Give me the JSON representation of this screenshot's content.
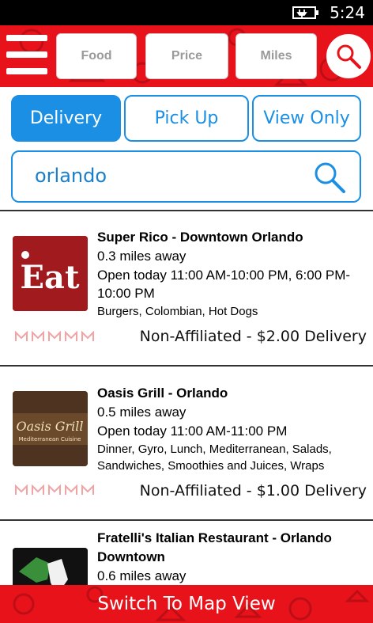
{
  "status_bar": {
    "time": "5:24",
    "battery_icon": "battery-charging-icon"
  },
  "header": {
    "menu_icon": "hamburger-menu-icon",
    "filters": [
      "Food",
      "Price",
      "Miles"
    ],
    "search_icon": "search-icon",
    "brand_color": "#e8121b"
  },
  "modes": {
    "items": [
      "Delivery",
      "Pick Up",
      "View Only"
    ],
    "selected": "Delivery",
    "accent": "#1a8fe3"
  },
  "search": {
    "value": "orlando"
  },
  "restaurants": [
    {
      "name": "Super Rico - Downtown Orlando",
      "distance": "0.3 miles away",
      "hours": "Open today 11:00 AM-10:00 PM, 6:00 PM-10:00 PM",
      "cuisine": "Burgers, Colombian, Hot Dogs",
      "fee": "Non-Affiliated - $2.00 Delivery",
      "logo_text": "Eat",
      "rating": 0
    },
    {
      "name": "Oasis Grill - Orlando",
      "distance": "0.5 miles away",
      "hours": "Open today 11:00 AM-11:00 PM",
      "cuisine": "Dinner, Gyro, Lunch, Mediterranean, Salads, Sandwiches, Smoothies and Juices, Wraps",
      "fee": "Non-Affiliated - $1.00 Delivery",
      "logo_text": "Oasis Grill",
      "logo_subtext": "Mediterranean Cuisine",
      "rating": 0
    },
    {
      "name": "Fratelli's Italian Restaurant - Orlando Downtown",
      "distance": "0.6 miles away",
      "logo_icon": "italy-map-icon"
    }
  ],
  "footer": {
    "label": "Switch To Map View"
  }
}
